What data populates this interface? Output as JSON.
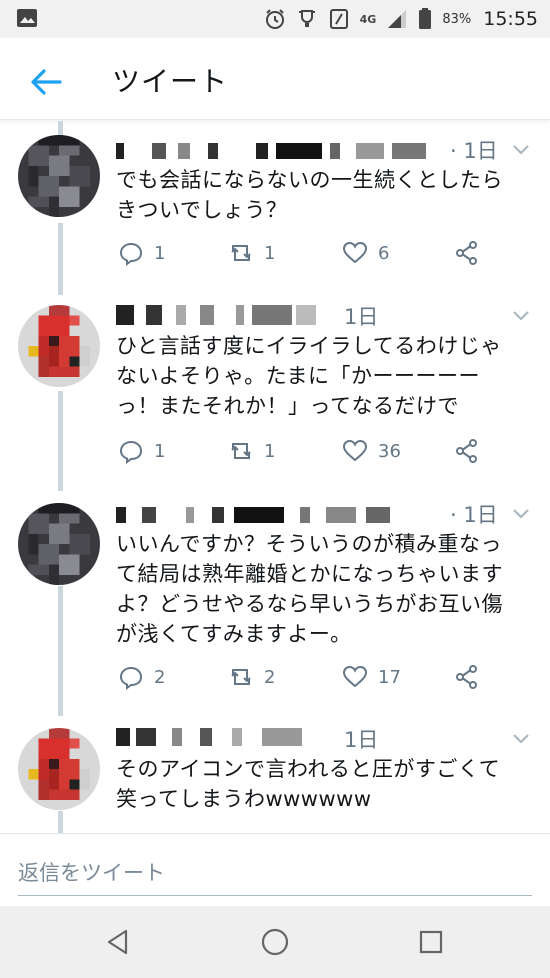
{
  "status_bar": {
    "network": "4G",
    "battery": "83%",
    "time": "15:55"
  },
  "header": {
    "title": "ツイート"
  },
  "tweets": [
    {
      "time": "· 1日",
      "text": "でも会話にならないの一生続くとしたら\nきついでしょう？",
      "replies": "1",
      "retweets": "1",
      "likes": "6"
    },
    {
      "time": "1日",
      "text": "ひと言話す度にイライラしてるわけじゃ\nないよそりゃ。たまに「かーーーーー\nっ！またそれか！」ってなるだけで",
      "replies": "1",
      "retweets": "1",
      "likes": "36"
    },
    {
      "time": "· 1日",
      "text": "いいんですか？そういうのが積み重なっ\nて結局は熟年離婚とかになっちゃいます\nよ？どうせやるなら早いうちがお互い傷\nが浅くてすみますよー。",
      "replies": "2",
      "retweets": "2",
      "likes": "17"
    },
    {
      "time": "1日",
      "text": "そのアイコンで言われると圧がすごくて\n笑ってしまうわwwwwww"
    }
  ],
  "reply_bar": {
    "placeholder": "返信をツイート"
  },
  "icons": {
    "back": "arrow-left-icon",
    "reply": "reply-icon",
    "retweet": "retweet-icon",
    "like": "heart-icon",
    "share": "share-icon",
    "caret": "chevron-down-icon"
  },
  "colors": {
    "accent": "#1da1f2",
    "muted": "#657786",
    "thread_line": "#ccd6dd"
  }
}
